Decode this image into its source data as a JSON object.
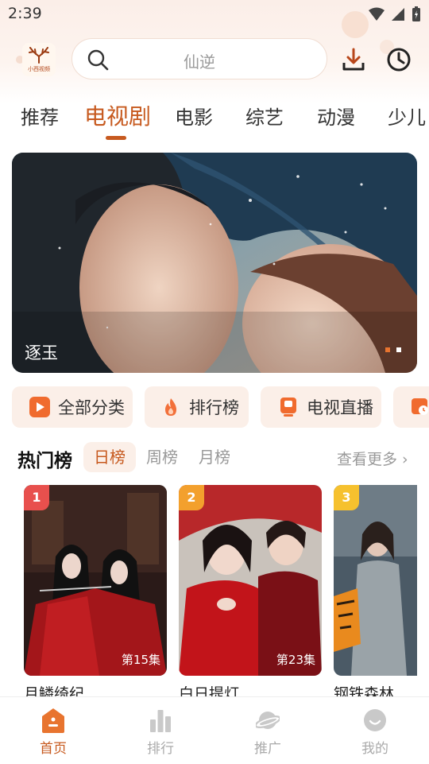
{
  "status": {
    "time": "2:39"
  },
  "header": {
    "logo_text": "小西视频",
    "search_placeholder": "仙逆"
  },
  "tabs": [
    "推荐",
    "电视剧",
    "电影",
    "综艺",
    "动漫",
    "少儿"
  ],
  "active_tab_index": 1,
  "banner": {
    "title": "逐玉"
  },
  "quick_actions": [
    {
      "label": "全部分类",
      "icon": "play-icon"
    },
    {
      "label": "排行榜",
      "icon": "fire-icon"
    },
    {
      "label": "电视直播",
      "icon": "tv-icon"
    },
    {
      "label": "",
      "icon": "history-icon"
    }
  ],
  "ranking": {
    "title": "热门榜",
    "periods": [
      "日榜",
      "周榜",
      "月榜"
    ],
    "active_period": "日榜",
    "more_label": "查看更多 ›",
    "cards": [
      {
        "rank": "1",
        "episode": "第15集",
        "title": "月鳞绮纪"
      },
      {
        "rank": "2",
        "episode": "第23集",
        "title": "白日提灯"
      },
      {
        "rank": "3",
        "episode": "",
        "title": "钢铁森林"
      }
    ]
  },
  "bottom_nav": [
    {
      "label": "首页",
      "icon": "home-icon",
      "active": true
    },
    {
      "label": "排行",
      "icon": "bar-chart-icon",
      "active": false
    },
    {
      "label": "推广",
      "icon": "planet-icon",
      "active": false
    },
    {
      "label": "我的",
      "icon": "smile-icon",
      "active": false
    }
  ],
  "colors": {
    "accent": "#c75a1f",
    "chip_bg": "#fbefe8",
    "badge1": "#e8504d",
    "badge2": "#f3a02d",
    "badge3": "#f6c12e"
  }
}
